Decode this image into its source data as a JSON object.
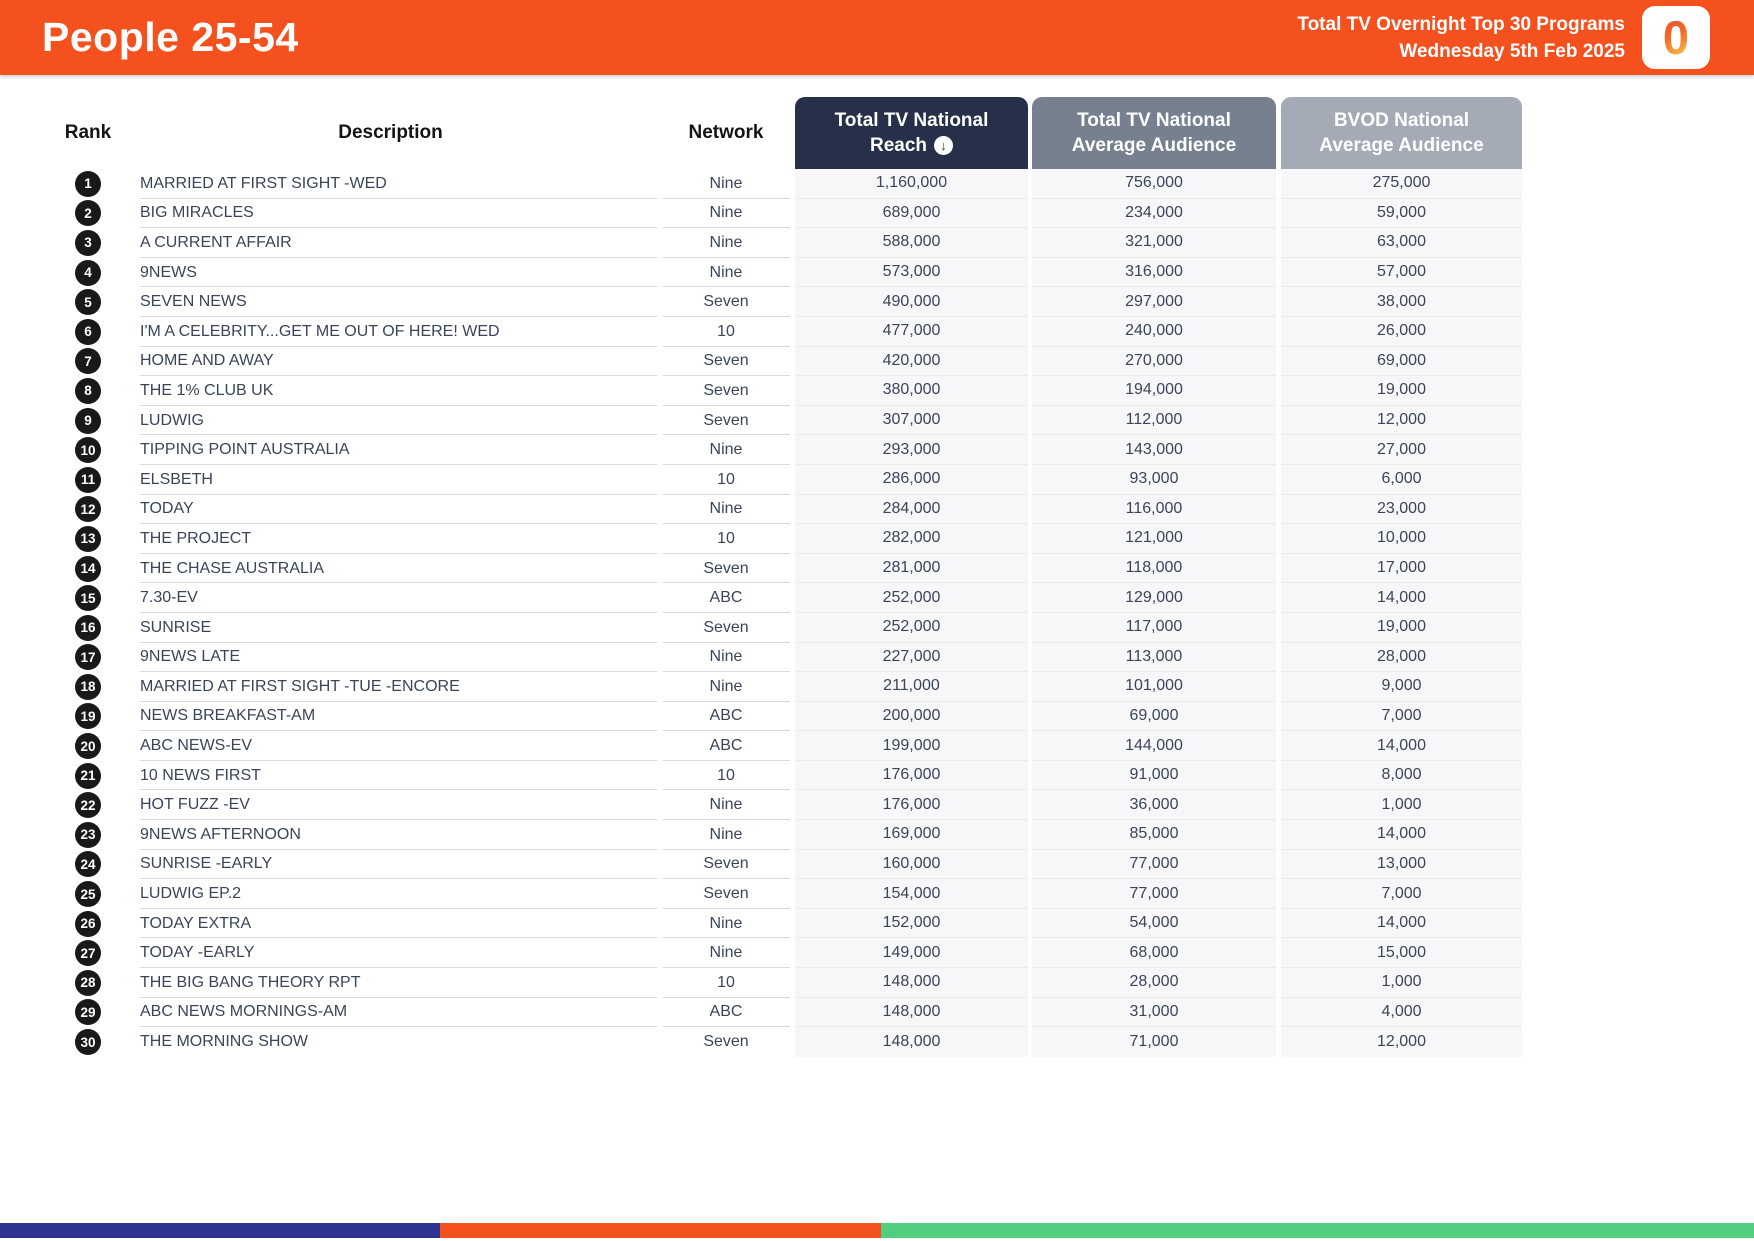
{
  "header": {
    "title": "People 25-54",
    "subtitle_line1": "Total TV Overnight Top 30 Programs",
    "subtitle_line2": "Wednesday 5th Feb 2025",
    "logo_text": "0",
    "background_color": "#F4511E"
  },
  "icons": {
    "sort_descending": "↓"
  },
  "table": {
    "columns": {
      "rank": "Rank",
      "description": "Description",
      "network": "Network",
      "reach": {
        "line1": "Total TV National",
        "line2": "Reach"
      },
      "avg_audience": {
        "line1": "Total TV National",
        "line2": "Average Audience"
      },
      "bvod": {
        "line1": "BVOD National",
        "line2": "Average Audience"
      }
    },
    "header_colors": {
      "reach": "#263149",
      "avg_audience": "#76808F",
      "bvod": "#A4ABB6"
    },
    "rows": [
      {
        "rank": "1",
        "description": "MARRIED AT FIRST SIGHT -WED",
        "network": "Nine",
        "reach": "1,160,000",
        "avg_audience": "756,000",
        "bvod": "275,000"
      },
      {
        "rank": "2",
        "description": "BIG MIRACLES",
        "network": "Nine",
        "reach": "689,000",
        "avg_audience": "234,000",
        "bvod": "59,000"
      },
      {
        "rank": "3",
        "description": "A CURRENT AFFAIR",
        "network": "Nine",
        "reach": "588,000",
        "avg_audience": "321,000",
        "bvod": "63,000"
      },
      {
        "rank": "4",
        "description": "9NEWS",
        "network": "Nine",
        "reach": "573,000",
        "avg_audience": "316,000",
        "bvod": "57,000"
      },
      {
        "rank": "5",
        "description": "SEVEN NEWS",
        "network": "Seven",
        "reach": "490,000",
        "avg_audience": "297,000",
        "bvod": "38,000"
      },
      {
        "rank": "6",
        "description": "I'M A CELEBRITY...GET ME OUT OF HERE! WED",
        "network": "10",
        "reach": "477,000",
        "avg_audience": "240,000",
        "bvod": "26,000"
      },
      {
        "rank": "7",
        "description": "HOME AND AWAY",
        "network": "Seven",
        "reach": "420,000",
        "avg_audience": "270,000",
        "bvod": "69,000"
      },
      {
        "rank": "8",
        "description": "THE 1% CLUB UK",
        "network": "Seven",
        "reach": "380,000",
        "avg_audience": "194,000",
        "bvod": "19,000"
      },
      {
        "rank": "9",
        "description": "LUDWIG",
        "network": "Seven",
        "reach": "307,000",
        "avg_audience": "112,000",
        "bvod": "12,000"
      },
      {
        "rank": "10",
        "description": "TIPPING POINT AUSTRALIA",
        "network": "Nine",
        "reach": "293,000",
        "avg_audience": "143,000",
        "bvod": "27,000"
      },
      {
        "rank": "11",
        "description": "ELSBETH",
        "network": "10",
        "reach": "286,000",
        "avg_audience": "93,000",
        "bvod": "6,000"
      },
      {
        "rank": "12",
        "description": "TODAY",
        "network": "Nine",
        "reach": "284,000",
        "avg_audience": "116,000",
        "bvod": "23,000"
      },
      {
        "rank": "13",
        "description": "THE PROJECT",
        "network": "10",
        "reach": "282,000",
        "avg_audience": "121,000",
        "bvod": "10,000"
      },
      {
        "rank": "14",
        "description": "THE CHASE AUSTRALIA",
        "network": "Seven",
        "reach": "281,000",
        "avg_audience": "118,000",
        "bvod": "17,000"
      },
      {
        "rank": "15",
        "description": "7.30-EV",
        "network": "ABC",
        "reach": "252,000",
        "avg_audience": "129,000",
        "bvod": "14,000"
      },
      {
        "rank": "16",
        "description": "SUNRISE",
        "network": "Seven",
        "reach": "252,000",
        "avg_audience": "117,000",
        "bvod": "19,000"
      },
      {
        "rank": "17",
        "description": "9NEWS LATE",
        "network": "Nine",
        "reach": "227,000",
        "avg_audience": "113,000",
        "bvod": "28,000"
      },
      {
        "rank": "18",
        "description": "MARRIED AT FIRST SIGHT -TUE -ENCORE",
        "network": "Nine",
        "reach": "211,000",
        "avg_audience": "101,000",
        "bvod": "9,000"
      },
      {
        "rank": "19",
        "description": "NEWS BREAKFAST-AM",
        "network": "ABC",
        "reach": "200,000",
        "avg_audience": "69,000",
        "bvod": "7,000"
      },
      {
        "rank": "20",
        "description": "ABC NEWS-EV",
        "network": "ABC",
        "reach": "199,000",
        "avg_audience": "144,000",
        "bvod": "14,000"
      },
      {
        "rank": "21",
        "description": "10 NEWS FIRST",
        "network": "10",
        "reach": "176,000",
        "avg_audience": "91,000",
        "bvod": "8,000"
      },
      {
        "rank": "22",
        "description": "HOT FUZZ -EV",
        "network": "Nine",
        "reach": "176,000",
        "avg_audience": "36,000",
        "bvod": "1,000"
      },
      {
        "rank": "23",
        "description": "9NEWS AFTERNOON",
        "network": "Nine",
        "reach": "169,000",
        "avg_audience": "85,000",
        "bvod": "14,000"
      },
      {
        "rank": "24",
        "description": "SUNRISE -EARLY",
        "network": "Seven",
        "reach": "160,000",
        "avg_audience": "77,000",
        "bvod": "13,000"
      },
      {
        "rank": "25",
        "description": "LUDWIG EP.2",
        "network": "Seven",
        "reach": "154,000",
        "avg_audience": "77,000",
        "bvod": "7,000"
      },
      {
        "rank": "26",
        "description": "TODAY EXTRA",
        "network": "Nine",
        "reach": "152,000",
        "avg_audience": "54,000",
        "bvod": "14,000"
      },
      {
        "rank": "27",
        "description": "TODAY -EARLY",
        "network": "Nine",
        "reach": "149,000",
        "avg_audience": "68,000",
        "bvod": "15,000"
      },
      {
        "rank": "28",
        "description": "THE BIG BANG THEORY RPT",
        "network": "10",
        "reach": "148,000",
        "avg_audience": "28,000",
        "bvod": "1,000"
      },
      {
        "rank": "29",
        "description": "ABC NEWS MORNINGS-AM",
        "network": "ABC",
        "reach": "148,000",
        "avg_audience": "31,000",
        "bvod": "4,000"
      },
      {
        "rank": "30",
        "description": "THE MORNING SHOW",
        "network": "Seven",
        "reach": "148,000",
        "avg_audience": "71,000",
        "bvod": "12,000"
      }
    ]
  },
  "footer": {
    "segments": [
      {
        "color": "#2F3490"
      },
      {
        "color": "#F4511E"
      },
      {
        "color": "#52CE81"
      }
    ]
  }
}
